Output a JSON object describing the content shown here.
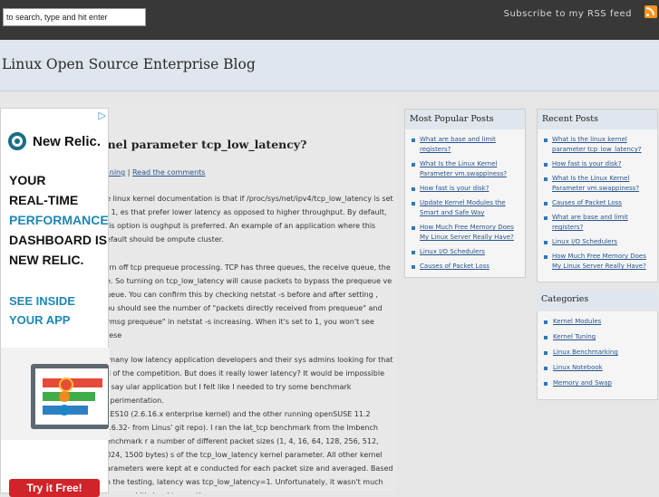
{
  "topbar": {
    "search_placeholder": "to search, type and hit enter",
    "rss_label": "Subscribe to my RSS feed"
  },
  "header": {
    "blog_title": "Linux Open Source Enterprise Blog"
  },
  "post": {
    "title": "rnel parameter tcp_low_latency?",
    "meta_link_1": "Tuning",
    "meta_sep": "|",
    "meta_link_2": "Read the comments",
    "paragraphs": [
      "he linux kernel documentation is that if /proc/sys/net/ipv4/tcp_low_latency is set to 1, es that prefer lower latency as opposed to higher throughput. By default, this option is oughput is preferred. An example of an application where this default should be ompute cluster.",
      "turn off tcp prequeue processing.  TCP has three queues, the receive queue, the ue.  So turning on tcp_low_latency will cause packets to bypass the prequeue ve queue.  You can confirm this by checking netstat -s before and after setting , you should see the number of \"packets directly received from prequeue\" and cvmsg prequeue\" in netstat -s increasing.  When it's set to 1, you won't see these",
      "y many low latency application developers and their sys admins looking for that ad of the competition.  But does it really lower latency?  It would be impossible to say ular application but I felt like I needed to try some benchmark experimentation.",
      "SLES10 (2.6.16.x enterprise kernel) and the other running openSUSE 11.2 (2.6.32- from Linus' git repo). I ran the lat_tcp benchmark from the lmbench benchmark r a number of different packet sizes (1, 4, 16, 64, 128, 256, 512, 1024, 1500 bytes) s of the tcp_low_latency kernel parameter.  All other kernel parameters were kept at e conducted for each packet size and averaged.  Based on the testing, latency was tcp_low_latency=1.  Unfortunately, it wasn't much lower and it's hard to see the"
    ]
  },
  "ad": {
    "brand": "New Relic.",
    "lines": [
      "YOUR",
      "REAL-TIME",
      "PERFORMANCE",
      "DASHBOARD IS",
      "NEW RELIC."
    ],
    "cta_lines": [
      "SEE INSIDE",
      "YOUR APP"
    ],
    "button": "Try it Free!"
  },
  "popular": {
    "title": "Most Popular Posts",
    "items": [
      "What are base and limit registers?",
      "What Is the Linux Kernel Parameter vm.swappiness?",
      "How fast is your disk?",
      "Update Kernel Modules the Smart and Safe Way",
      "How Much Free Memory Does My Linux Server Really Have?",
      "Linux I/O Schedulers",
      "Causes of Packet Loss"
    ]
  },
  "recent": {
    "title": "Recent Posts",
    "items": [
      "What is the linux kernel parameter tcp_low_latency?",
      "How fast is your disk?",
      "What Is the Linux Kernel Parameter vm.swappiness?",
      "Causes of Packet Loss",
      "What are base and limit registers?",
      "Linux I/O Schedulers",
      "How Much Free Memory Does My Linux Server Really Have?"
    ]
  },
  "categories": {
    "title": "Categories",
    "items": [
      "Kernel Modules",
      "Kernel Tuning",
      "Linux Benchmarking",
      "Linux Notebook",
      "Memory and Swap"
    ]
  }
}
